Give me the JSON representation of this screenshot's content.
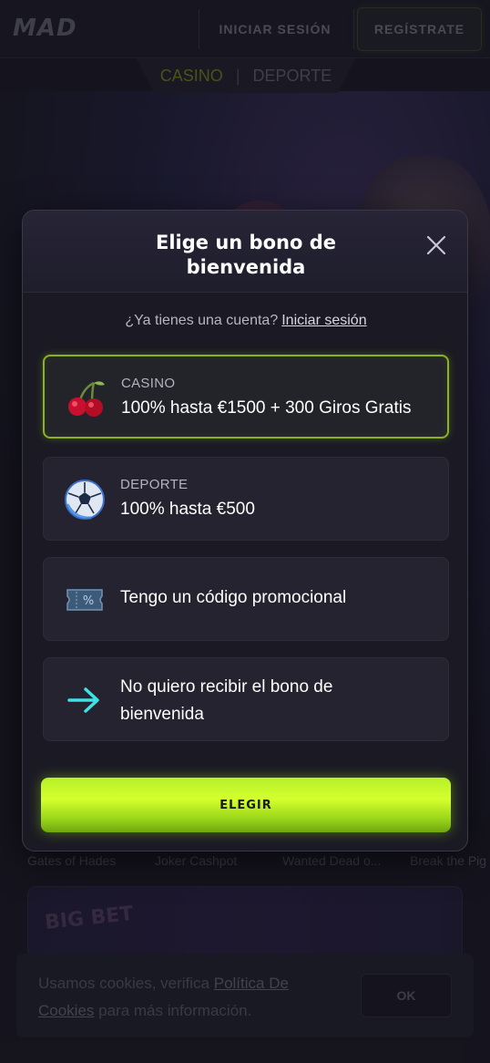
{
  "header": {
    "logo_text": "MAD",
    "login_label": "INICIAR SESIÓN",
    "register_label": "REGÍSTRATE"
  },
  "modes": {
    "casino": "CASINO",
    "separator": "|",
    "sport": "DEPORTE"
  },
  "games": [
    "Gates of Hades",
    "Joker Cashpot",
    "Wanted Dead o...",
    "Break the Pig"
  ],
  "promo_banner": {
    "badge": "BIG BET"
  },
  "cookie": {
    "text_before": "Usamos cookies, verifica ",
    "link": "Política De Cookies",
    "text_after": " para más información.",
    "ok_label": "OK"
  },
  "modal": {
    "title": "Elige un bono de bienvenida",
    "close_icon": "close-icon",
    "login_prompt": "¿Ya tienes una cuenta?",
    "login_link": "Iniciar sesión",
    "options": [
      {
        "icon": "cherries-icon",
        "label": "CASINO",
        "value": "100% hasta €1500 + 300 Giros Gratis",
        "selected": true
      },
      {
        "icon": "soccer-ball-icon",
        "label": "DEPORTE",
        "value": "100% hasta €500",
        "selected": false
      },
      {
        "icon": "promo-ticket-icon",
        "value": "Tengo un código promocional",
        "selected": false
      },
      {
        "icon": "arrow-right-icon",
        "value": "No quiero recibir el bono de bienvenida",
        "selected": false
      }
    ],
    "choose_label": "ELEGIR"
  },
  "colors": {
    "accent": "#b8f02a",
    "background": "#1c1b26",
    "modal_bg": "#1b1a24",
    "selected_border": "#8ab31e"
  }
}
